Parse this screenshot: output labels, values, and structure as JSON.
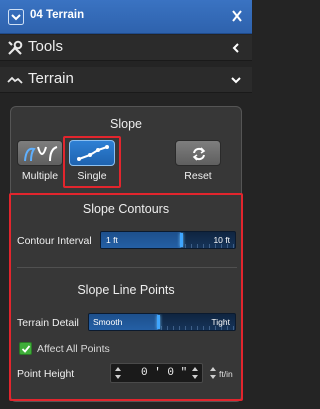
{
  "header": {
    "title": "04 Terrain"
  },
  "sections": {
    "tools": {
      "label": "Tools"
    },
    "terrain": {
      "label": "Terrain"
    }
  },
  "slope": {
    "heading": "Slope",
    "multiple_label": "Multiple",
    "single_label": "Single",
    "reset_label": "Reset"
  },
  "slope_contours": {
    "heading": "Slope Contours",
    "contour_interval_label": "Contour Interval",
    "min_label": "1 ft",
    "max_label": "10 ft",
    "level": 0.6
  },
  "slope_line_points": {
    "heading": "Slope Line Points",
    "terrain_detail_label": "Terrain Detail",
    "min_label": "Smooth",
    "max_label": "Tight",
    "level": 0.47,
    "affect_all_label": "Affect All Points",
    "affect_all_checked": true,
    "point_height_label": "Point Height",
    "point_height_value": "0 ' 0 \"",
    "unit_label": "ft/in"
  },
  "colors": {
    "header": "#3a73c2",
    "highlight": "#e2252d",
    "active": "#2e80d4"
  }
}
